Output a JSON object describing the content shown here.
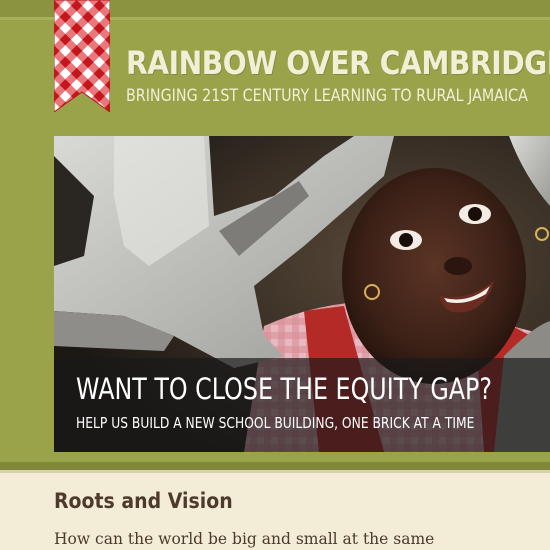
{
  "header": {
    "title": "RAINBOW OVER CAMBRIDGE",
    "subtitle": "BRINGING 21ST CENTURY LEARNING TO RURAL JAMAICA",
    "logo_icon": "gingham-ribbon-icon"
  },
  "hero": {
    "image": "child-peeking-through-concrete-block-photo",
    "heading": "WANT TO CLOSE THE EQUITY GAP?",
    "subheading": "HELP US BUILD A NEW SCHOOL BUILDING, ONE BRICK AT A TIME"
  },
  "content": {
    "section_title": "Roots and Vision",
    "intro_text": "How can the world be big and small at the same"
  },
  "colors": {
    "header_green": "#9aa24a",
    "page_cream": "#f3edd7",
    "title_text": "#f3eed6",
    "heading_brown": "#4d3a2a",
    "ribbon_red": "#d8262c"
  }
}
